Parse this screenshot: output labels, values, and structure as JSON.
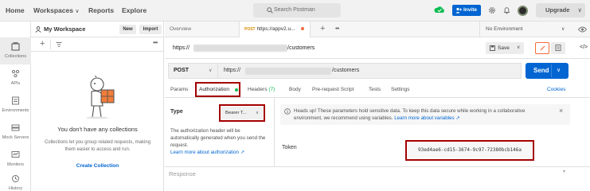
{
  "topbar": {
    "nav": [
      "Home",
      "Workspaces",
      "Reports",
      "Explore"
    ],
    "search_placeholder": "Search Postman",
    "invite_label": "Invite",
    "upgrade_label": "Upgrade"
  },
  "rail": [
    {
      "label": "Collections",
      "icon": "collections-icon"
    },
    {
      "label": "APIs",
      "icon": "apis-icon"
    },
    {
      "label": "Environments",
      "icon": "environments-icon"
    },
    {
      "label": "Mock Servers",
      "icon": "mock-servers-icon"
    },
    {
      "label": "Monitors",
      "icon": "monitors-icon"
    },
    {
      "label": "History",
      "icon": "history-icon"
    }
  ],
  "workspace": {
    "title": "My Workspace",
    "new_label": "New",
    "import_label": "Import",
    "empty_title": "You don't have any collections",
    "empty_desc": "Collections let you group related requests, making them easier to access and run.",
    "create_label": "Create Collection"
  },
  "tabs": {
    "overview": "Overview",
    "request_method": "POST",
    "request_name": "https://appv2.u...",
    "environment": "No Environment"
  },
  "request": {
    "title_prefix": "https://",
    "title_suffix": "/customers",
    "save_label": "Save",
    "method": "POST",
    "url_prefix": "https://",
    "url_suffix": "/customers",
    "send_label": "Send"
  },
  "subtabs": {
    "params": "Params",
    "authorization": "Authorization",
    "headers": "Headers",
    "headers_count": "(7)",
    "body": "Body",
    "prerequest": "Pre-request Script",
    "tests": "Tests",
    "settings": "Settings",
    "cookies": "Cookies"
  },
  "auth": {
    "type_label": "Type",
    "type_value": "Bearer T...",
    "desc": "The authorization header will be automatically generated when you send the request.",
    "learn_more": "Learn more about authorization ↗",
    "notice": "Heads up! These parameters hold sensitive data. To keep this data secure while working in a collaborative environment, we recommend using variables.",
    "notice_link": "Learn more about variables ↗",
    "token_label": "Token",
    "token_value": "93ed4ae6-cd15-3674-9c97-72380bcb146a"
  },
  "response": {
    "label": "Response"
  },
  "colors": {
    "accent": "#0265d2",
    "highlight": "#a30000",
    "unsaved_dot": "#f26b3a",
    "success": "#0cbb52"
  }
}
